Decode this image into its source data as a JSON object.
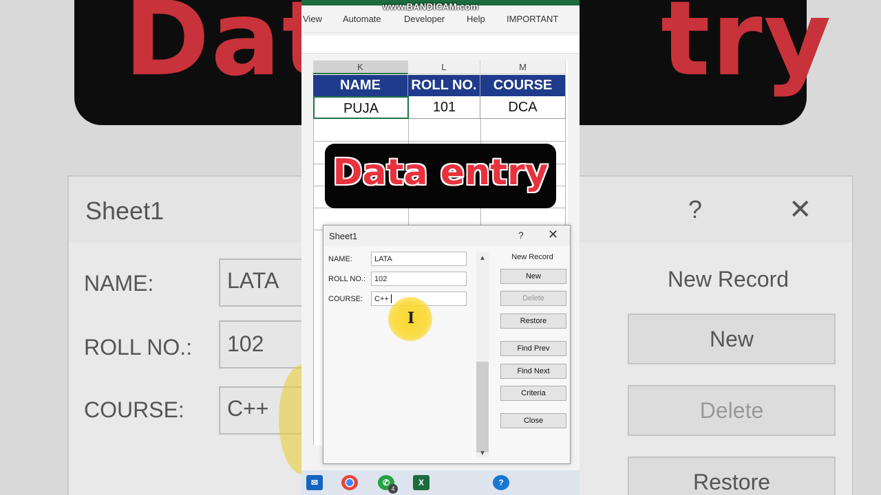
{
  "watermark": "www.BANDICAM.com",
  "ribbon": {
    "tabs": [
      "View",
      "Automate",
      "Developer",
      "Help",
      "IMPORTANT"
    ]
  },
  "sheet": {
    "columns": [
      "K",
      "L",
      "M"
    ],
    "headers": [
      "NAME",
      "ROLL NO.",
      "COURSE"
    ],
    "row1": [
      "PUJA",
      "101",
      "DCA"
    ]
  },
  "overlay_title": "Data entry",
  "dialog": {
    "title": "Sheet1",
    "help": "?",
    "close": "✕",
    "fields": [
      {
        "label": "NAME:",
        "value": "LATA"
      },
      {
        "label": "ROLL NO.:",
        "value": "102"
      },
      {
        "label": "COURSE:",
        "value": "C++"
      }
    ],
    "record_status": "New Record",
    "buttons": {
      "new": "New",
      "delete": "Delete",
      "restore": "Restore",
      "find_prev": "Find Prev",
      "find_next": "Find Next",
      "criteria": "Criteria",
      "close": "Close"
    }
  },
  "background_zoom": {
    "title": "Sheet1",
    "help": "?",
    "close": "✕",
    "labels": [
      "NAME:",
      "ROLL NO.:",
      "COURSE:"
    ],
    "values": [
      "LATA",
      "102",
      "C++"
    ],
    "record_status": "New Record",
    "buttons": [
      "New",
      "Delete",
      "Restore"
    ],
    "banner_left": "Dat",
    "banner_right": "try"
  },
  "taskbar": {
    "icons": [
      "mail-icon",
      "chrome-icon",
      "whatsapp-icon",
      "excel-icon",
      "help-icon"
    ],
    "whatsapp_badge": "4",
    "excel_letter": "X"
  }
}
